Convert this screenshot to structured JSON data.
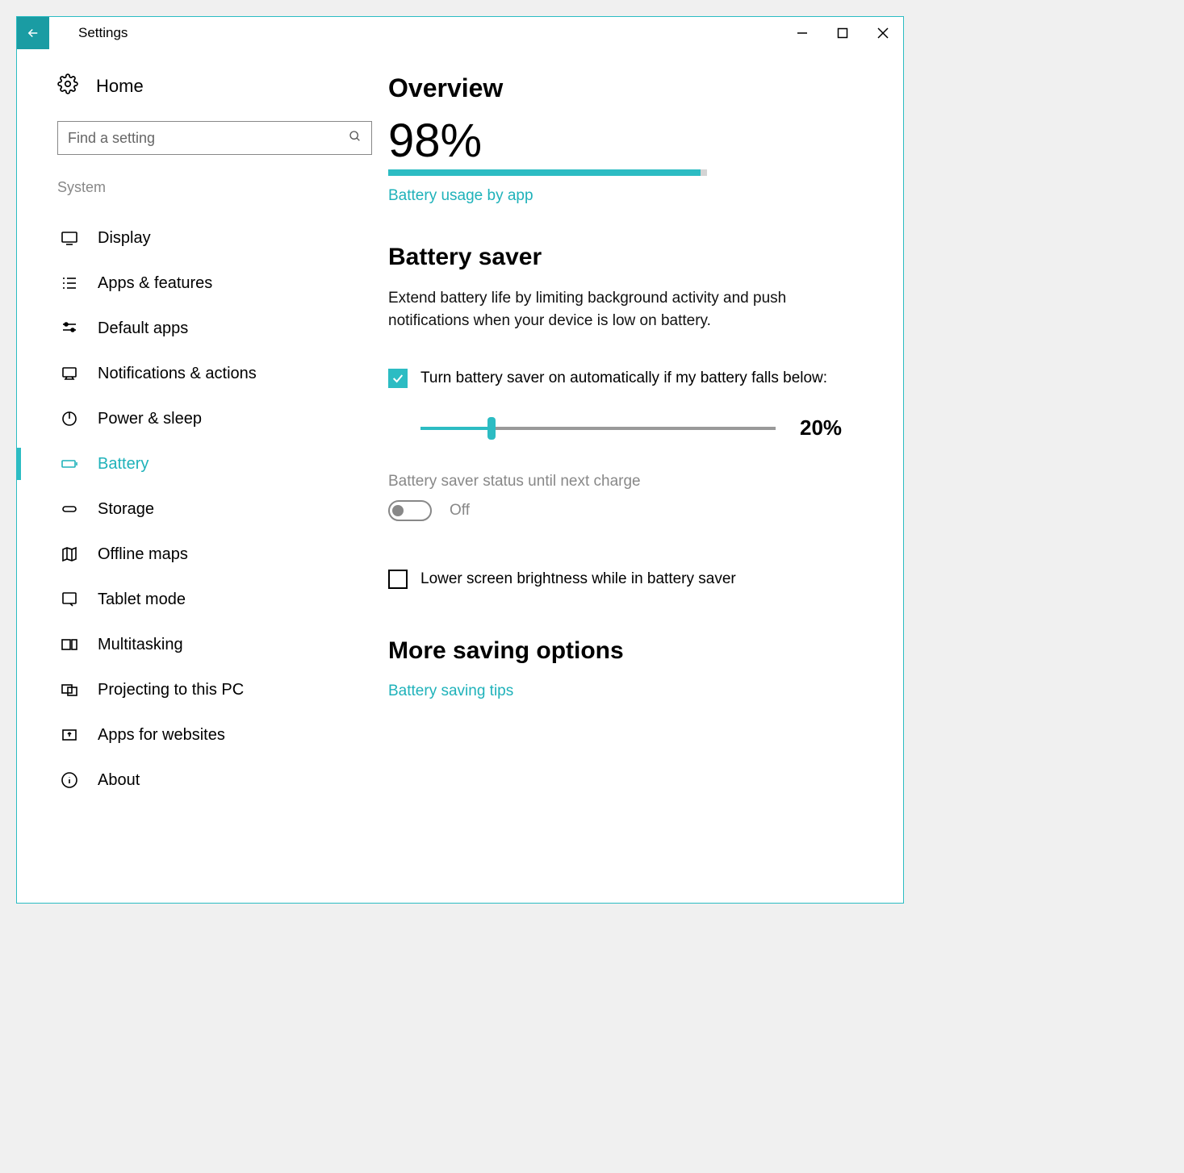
{
  "titlebar": {
    "title": "Settings"
  },
  "sidebar": {
    "home": "Home",
    "search_placeholder": "Find a setting",
    "section": "System",
    "items": [
      {
        "label": "Display",
        "icon": "display"
      },
      {
        "label": "Apps & features",
        "icon": "apps"
      },
      {
        "label": "Default apps",
        "icon": "default"
      },
      {
        "label": "Notifications & actions",
        "icon": "notify"
      },
      {
        "label": "Power & sleep",
        "icon": "power"
      },
      {
        "label": "Battery",
        "icon": "battery",
        "active": true
      },
      {
        "label": "Storage",
        "icon": "storage"
      },
      {
        "label": "Offline maps",
        "icon": "maps"
      },
      {
        "label": "Tablet mode",
        "icon": "tablet"
      },
      {
        "label": "Multitasking",
        "icon": "multitask"
      },
      {
        "label": "Projecting to this PC",
        "icon": "project"
      },
      {
        "label": "Apps for websites",
        "icon": "appsweb"
      },
      {
        "label": "About",
        "icon": "about"
      }
    ]
  },
  "main": {
    "overview_heading": "Overview",
    "battery_pct": "98%",
    "battery_fill": 98,
    "usage_link": "Battery usage by app",
    "saver_heading": "Battery saver",
    "saver_desc": "Extend battery life by limiting background activity and push notifications when your device is low on battery.",
    "auto_on_label": "Turn battery saver on automatically if my battery falls below:",
    "slider_pct": "20%",
    "slider_value": 20,
    "status_label": "Battery saver status until next charge",
    "status_value": "Off",
    "brightness_label": "Lower screen brightness while in battery saver",
    "more_heading": "More saving options",
    "tips_link": "Battery saving tips"
  }
}
